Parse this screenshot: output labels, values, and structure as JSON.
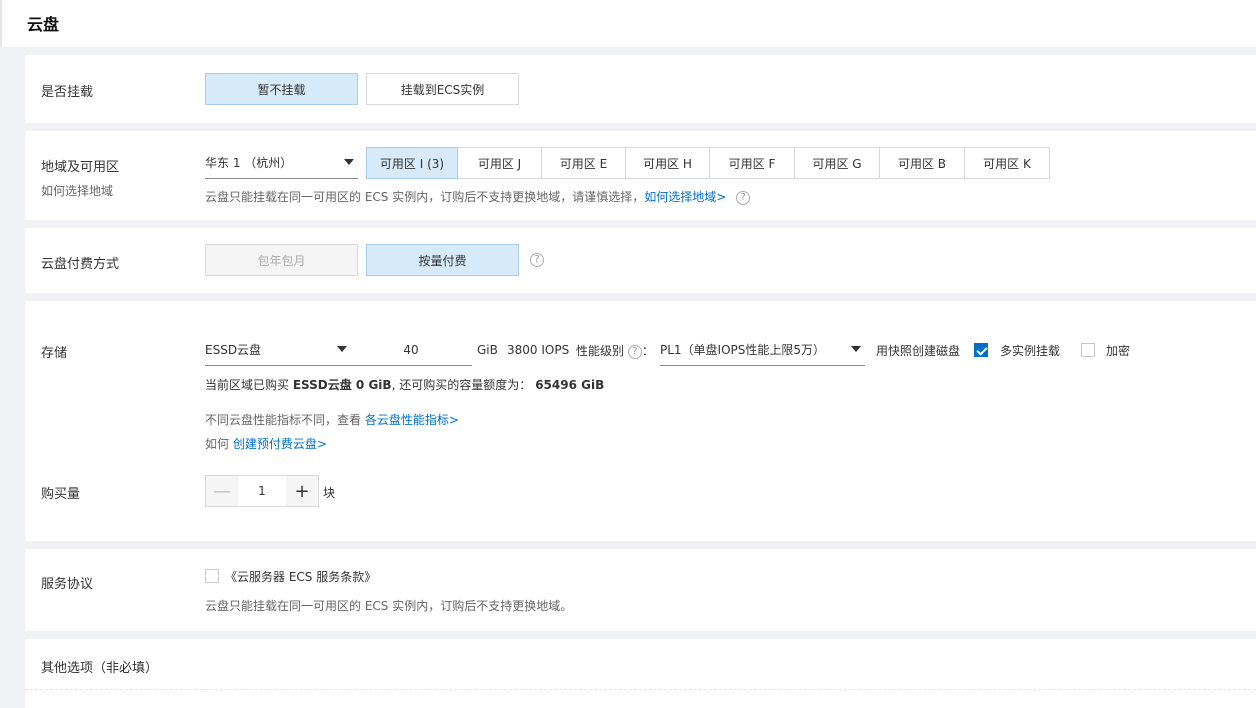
{
  "page_title": "云盘",
  "mount": {
    "label": "是否挂载",
    "options": [
      "暂不挂载",
      "挂载到ECS实例"
    ],
    "selected": "暂不挂载"
  },
  "region": {
    "label": "地域及可用区",
    "sublabel": "如何选择地域",
    "region_value": "华东 1 （杭州）",
    "zones": [
      "可用区 I (3)",
      "可用区 J",
      "可用区 E",
      "可用区 H",
      "可用区 F",
      "可用区 G",
      "可用区 B",
      "可用区 K"
    ],
    "selected_zone": "可用区 I (3)",
    "hint": "云盘只能挂载在同一可用区的 ECS 实例内，订购后不支持更换地域，请谨慎选择，",
    "hint_link": "如何选择地域>",
    "help_glyph": "?"
  },
  "billing": {
    "label": "云盘付费方式",
    "options": [
      "包年包月",
      "按量付费"
    ],
    "selected": "按量付费",
    "help_glyph": "?"
  },
  "storage": {
    "label": "存储",
    "disk_type": "ESSD云盘",
    "size": "40",
    "unit": "GiB",
    "iops": "3800 IOPS",
    "perf_label": "性能级别",
    "perf_colon": "：",
    "perf_value": "PL1（单盘IOPS性能上限5万）",
    "snapshot_link": "用快照创建磁盘",
    "multi_mount_label": "多实例挂载",
    "multi_mount_checked": true,
    "encrypt_label": "加密",
    "encrypt_checked": false,
    "quota_prefix": "当前区域已购买 ",
    "quota_bought": "ESSD云盘 0 GiB",
    "quota_mid": ", 还可购买的容量额度为：",
    "quota_remaining": "65496 GiB",
    "perf_hint": "不同云盘性能指标不同，查看 ",
    "perf_hint_link": "各云盘性能指标>",
    "prepay_prefix": "如何 ",
    "prepay_link": "创建预付费云盘>",
    "help_glyph": "?"
  },
  "quantity": {
    "label": "购买量",
    "value": "1",
    "unit": "块",
    "minus_glyph": "—",
    "plus_glyph": "+"
  },
  "agreement": {
    "label": "服务协议",
    "link": "《云服务器 ECS 服务条款》",
    "hint": "云盘只能挂载在同一可用区的 ECS 实例内，订购后不支持更换地域。",
    "checked": false
  },
  "other": {
    "label": "其他选项（非必填）"
  }
}
